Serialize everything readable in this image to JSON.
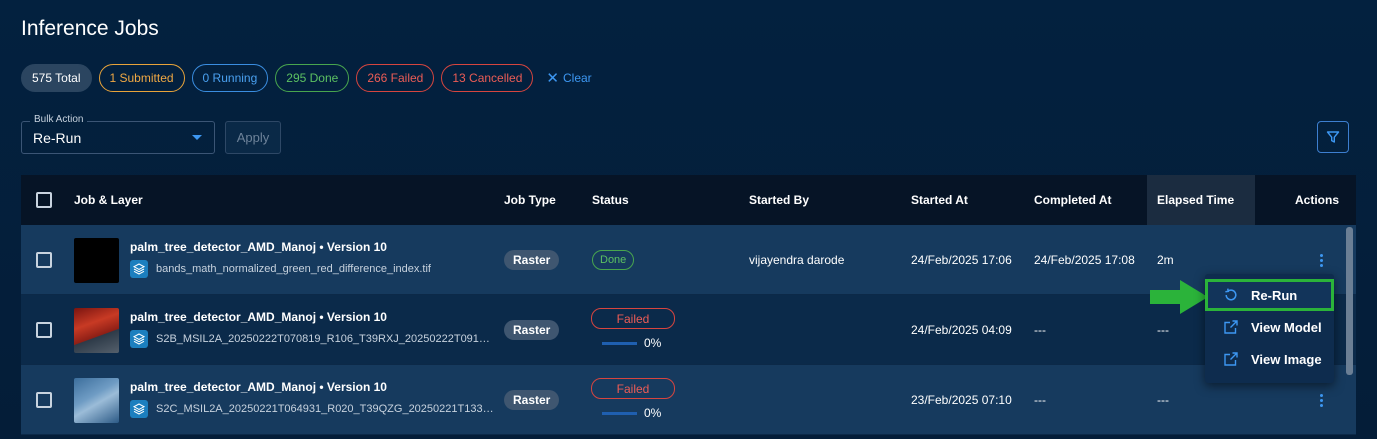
{
  "page": {
    "title": "Inference Jobs"
  },
  "filters": {
    "total": "575 Total",
    "submitted": "1 Submitted",
    "running": "0 Running",
    "done": "295 Done",
    "failed": "266 Failed",
    "cancelled": "13 Cancelled",
    "clear": "Clear"
  },
  "bulk_action": {
    "legend": "Bulk Action",
    "value": "Re-Run",
    "apply": "Apply"
  },
  "table": {
    "headers": {
      "job_layer": "Job & Layer",
      "job_type": "Job Type",
      "status": "Status",
      "started_by": "Started By",
      "started_at": "Started At",
      "completed_at": "Completed At",
      "elapsed_time": "Elapsed Time",
      "actions": "Actions"
    },
    "rows": [
      {
        "job": "palm_tree_detector_AMD_Manoj • Version 10",
        "layer": "bands_math_normalized_green_red_difference_index.tif",
        "type": "Raster",
        "status": "Done",
        "started_by": "vijayendra darode",
        "started_at": "24/Feb/2025 17:06",
        "completed_at": "24/Feb/2025 17:08",
        "elapsed": "2m"
      },
      {
        "job": "palm_tree_detector_AMD_Manoj • Version 10",
        "layer": "S2B_MSIL2A_20250222T070819_R106_T39RXJ_20250222T09164...",
        "type": "Raster",
        "status": "Failed",
        "progress": "0%",
        "progress_value": 0,
        "started_by": "",
        "started_at": "24/Feb/2025 04:09",
        "completed_at": "---",
        "elapsed": "---"
      },
      {
        "job": "palm_tree_detector_AMD_Manoj • Version 10",
        "layer": "S2C_MSIL2A_20250221T064931_R020_T39QZG_20250221T1339...",
        "type": "Raster",
        "status": "Failed",
        "progress": "0%",
        "progress_value": 0,
        "started_by": "",
        "started_at": "23/Feb/2025 07:10",
        "completed_at": "---",
        "elapsed": "---"
      }
    ]
  },
  "actions_menu": {
    "items": [
      {
        "label": "Re-Run",
        "icon": "rerun-icon",
        "highlighted": true
      },
      {
        "label": "View Model",
        "icon": "external-link-icon"
      },
      {
        "label": "View Image",
        "icon": "external-link-icon"
      }
    ]
  },
  "colors": {
    "background": "#03213f",
    "accent": "#3d97f2",
    "done": "#5cc162",
    "failed": "#ec5c56",
    "submitted": "#f0a844",
    "highlight": "#2bb33a"
  }
}
